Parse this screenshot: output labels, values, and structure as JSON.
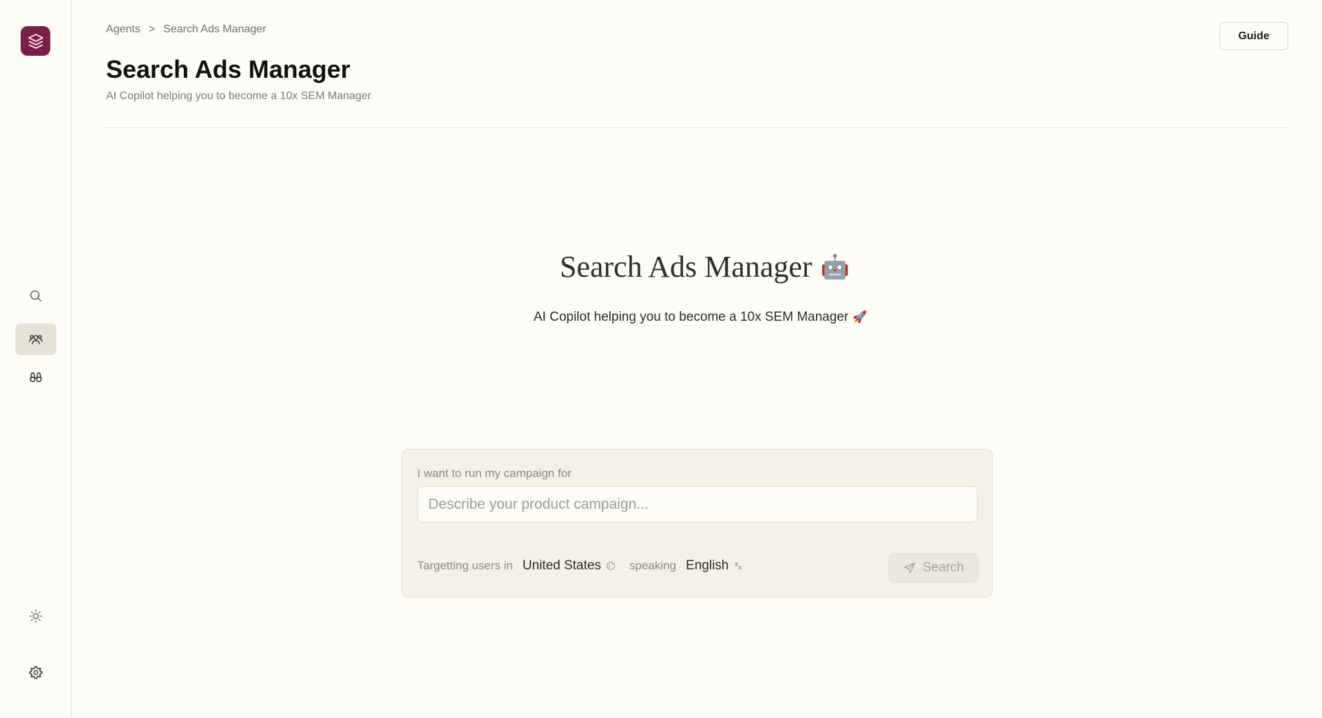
{
  "breadcrumb": {
    "root": "Agents",
    "separator": ">",
    "current": "Search Ads Manager"
  },
  "header": {
    "title": "Search Ads Manager",
    "subtitle": "AI Copilot helping you to become a 10x SEM Manager",
    "guide_label": "Guide"
  },
  "hero": {
    "title": "Search Ads Manager",
    "title_emoji": "🤖",
    "subtitle": "AI Copilot helping you to become a 10x SEM Manager",
    "subtitle_emoji": "🚀"
  },
  "campaign": {
    "label": "I want to run my campaign for",
    "input_value": "",
    "input_placeholder": "Describe your product campaign...",
    "targeting_prefix": "Targetting users in",
    "country": "United States",
    "speaking_label": "speaking",
    "language": "English",
    "search_label": "Search"
  },
  "sidebar": {
    "items": [
      {
        "name": "search",
        "icon": "search-icon",
        "active": false
      },
      {
        "name": "agents",
        "icon": "users-icon",
        "active": true
      },
      {
        "name": "explore",
        "icon": "binoculars-icon",
        "active": false
      },
      {
        "name": "theme",
        "icon": "sun-icon",
        "active": false
      },
      {
        "name": "settings",
        "icon": "gear-icon",
        "active": false
      }
    ]
  },
  "colors": {
    "background": "#fdfcf6",
    "logo": "#7a1f4a",
    "active_nav": "#e6e3d6",
    "card": "#f4f2e7"
  }
}
